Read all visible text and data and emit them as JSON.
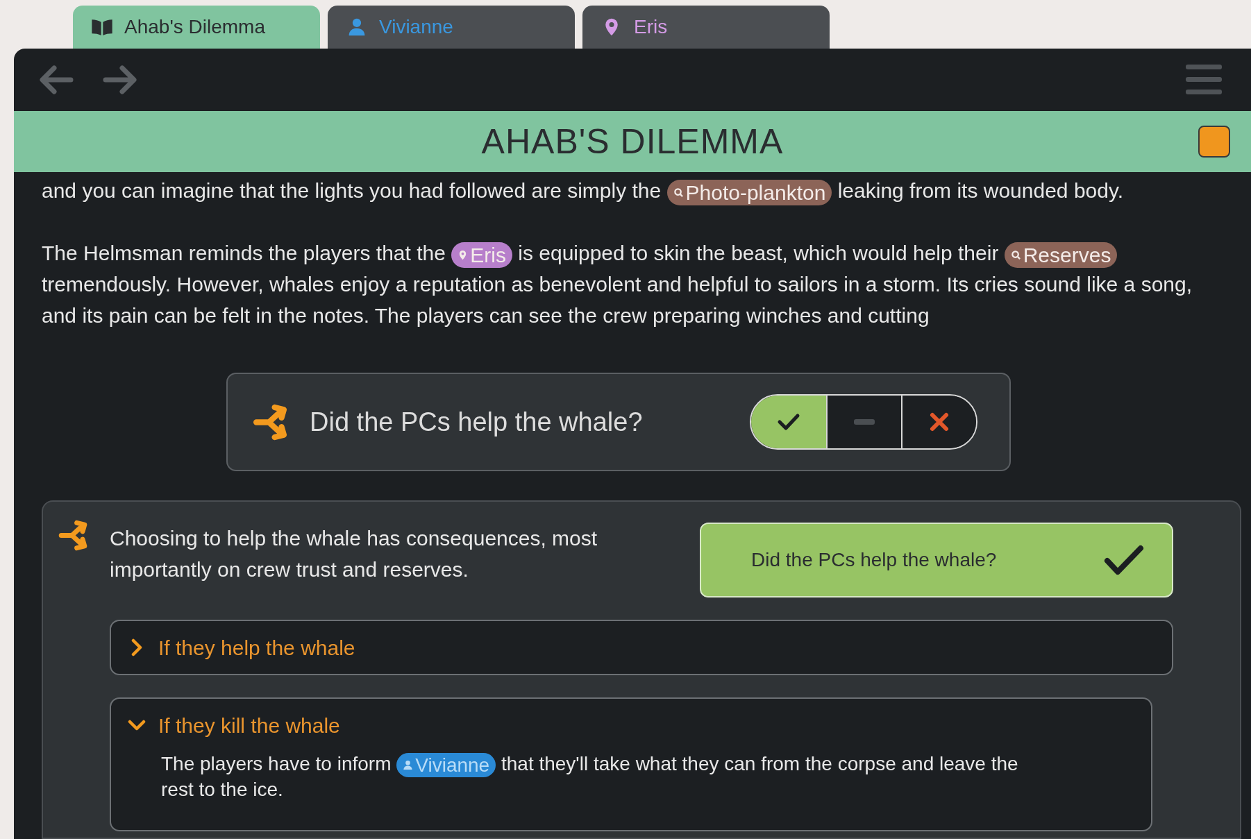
{
  "tabs": [
    {
      "kind": "book",
      "label": "Ahab's Dilemma",
      "selected": true
    },
    {
      "kind": "person",
      "label": "Vivianne",
      "selected": false
    },
    {
      "kind": "place",
      "label": "Eris",
      "selected": false
    }
  ],
  "header": {
    "title": "AHAB'S DILEMMA"
  },
  "paragraphs": [
    [
      {
        "kind": "text",
        "text": "and you can imagine that the lights you had followed are simply the "
      },
      {
        "kind": "search",
        "text": "Photo-plankton"
      },
      {
        "kind": "text",
        "text": " leaking from its wounded body."
      }
    ],
    [
      {
        "kind": "text",
        "text": "The Helmsman reminds the players that the "
      },
      {
        "kind": "place",
        "text": "Eris"
      },
      {
        "kind": "text",
        "text": " is equipped to skin the beast, which would help their "
      },
      {
        "kind": "search",
        "text": "Reserves"
      },
      {
        "kind": "text",
        "text": " tremendously. However, whales enjoy a reputation as benevolent and helpful to sailors in a storm. Its cries sound like a song, and its pain can be felt in the notes. The players can see the crew preparing winches and cutting"
      }
    ]
  ],
  "decision": {
    "question": "Did the PCs help the whale?",
    "options": [
      {
        "kind": "yes",
        "selected": true
      },
      {
        "kind": "skip",
        "selected": false
      },
      {
        "kind": "no",
        "selected": false
      }
    ]
  },
  "branch": {
    "description": "Choosing to help the whale has consequences, most importantly on crew trust and reserves.",
    "result": {
      "question": "Did the PCs help the whale?",
      "kind": "yes"
    },
    "sections": [
      {
        "title": "If they help the whale",
        "expanded": false
      },
      {
        "title": "If they kill the whale",
        "expanded": true,
        "body": [
          {
            "kind": "text",
            "text": "The players have to inform "
          },
          {
            "kind": "person",
            "text": "Vivianne"
          },
          {
            "kind": "text",
            "text": " that they'll take what they can from the corpse and leave the rest to the ice."
          }
        ]
      }
    ]
  }
}
